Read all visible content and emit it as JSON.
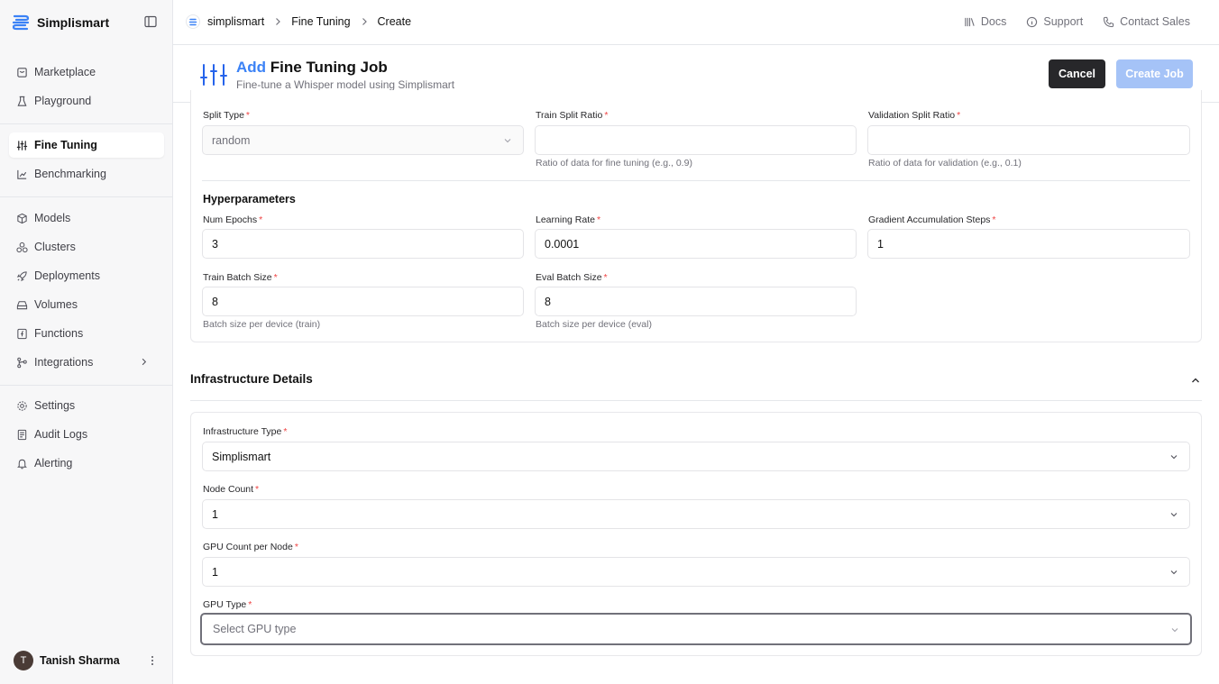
{
  "brand": {
    "name": "Simplismart",
    "color": "#3b82f6"
  },
  "sidebar": {
    "group1": [
      {
        "label": "Marketplace",
        "icon": "store-icon"
      },
      {
        "label": "Playground",
        "icon": "flask-icon"
      }
    ],
    "group2": [
      {
        "label": "Fine Tuning",
        "icon": "sliders-icon",
        "active": true
      },
      {
        "label": "Benchmarking",
        "icon": "chart-icon"
      }
    ],
    "group3": [
      {
        "label": "Models",
        "icon": "cube-icon"
      },
      {
        "label": "Clusters",
        "icon": "cluster-icon"
      },
      {
        "label": "Deployments",
        "icon": "rocket-icon"
      },
      {
        "label": "Volumes",
        "icon": "drive-icon"
      },
      {
        "label": "Functions",
        "icon": "function-icon"
      },
      {
        "label": "Integrations",
        "icon": "integration-icon"
      }
    ],
    "group4": [
      {
        "label": "Settings",
        "icon": "gear-icon"
      },
      {
        "label": "Audit Logs",
        "icon": "log-icon"
      },
      {
        "label": "Alerting",
        "icon": "bell-icon"
      }
    ],
    "user": {
      "initial": "T",
      "name": "Tanish Sharma"
    }
  },
  "topbar": {
    "breadcrumbs": [
      "simplismart",
      "Fine Tuning",
      "Create"
    ],
    "links": [
      "Docs",
      "Support",
      "Contact Sales"
    ]
  },
  "header": {
    "title_accent": "Add",
    "title_rest": " Fine Tuning Job",
    "subtitle": "Fine-tune a Whisper model using Simplismart",
    "cancel_label": "Cancel",
    "create_label": "Create Job"
  },
  "split": {
    "split_type": {
      "label": "Split Type",
      "value": "random"
    },
    "train_ratio": {
      "label": "Train Split Ratio",
      "value": "",
      "hint": "Ratio of data for fine tuning (e.g., 0.9)"
    },
    "val_ratio": {
      "label": "Validation Split Ratio",
      "value": "",
      "hint": "Ratio of data for validation (e.g., 0.1)"
    }
  },
  "hyper": {
    "title": "Hyperparameters",
    "epochs": {
      "label": "Num Epochs",
      "value": "3"
    },
    "lr": {
      "label": "Learning Rate",
      "value": "0.0001"
    },
    "grad": {
      "label": "Gradient Accumulation Steps",
      "value": "1"
    },
    "train_bs": {
      "label": "Train Batch Size",
      "value": "8",
      "hint": "Batch size per device (train)"
    },
    "eval_bs": {
      "label": "Eval Batch Size",
      "value": "8",
      "hint": "Batch size per device (eval)"
    }
  },
  "infra": {
    "title": "Infrastructure Details",
    "type": {
      "label": "Infrastructure Type",
      "value": "Simplismart"
    },
    "nodes": {
      "label": "Node Count",
      "value": "1"
    },
    "gpus": {
      "label": "GPU Count per Node",
      "value": "1"
    },
    "gpu_type": {
      "label": "GPU Type",
      "placeholder": "Select GPU type"
    }
  }
}
